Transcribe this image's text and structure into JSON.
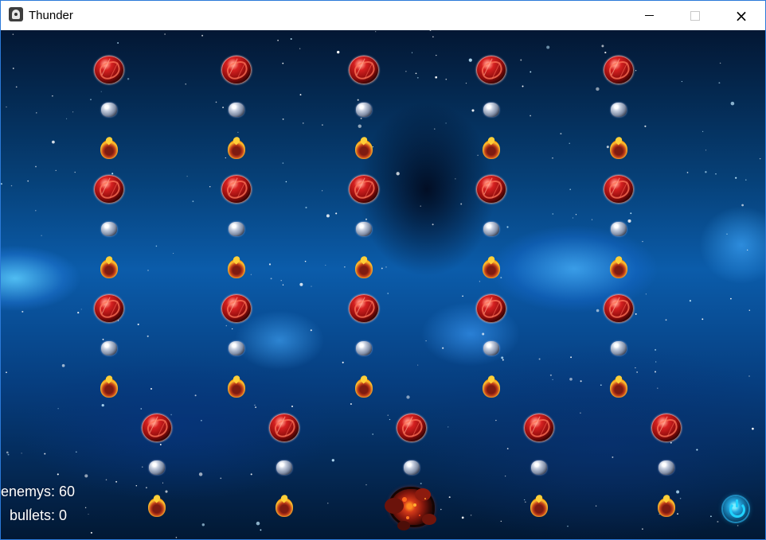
{
  "window": {
    "title": "Thunder",
    "minimize_icon": "minimize-icon",
    "maximize_icon": "maximize-icon",
    "close_icon": "close-icon",
    "close_glyph": "×"
  },
  "game": {
    "stats": {
      "enemy_count_label": "enemys: 60",
      "bullet_count_label": "bullets: 0"
    },
    "background": "starry blue space",
    "enemy_types": [
      "red-rock-enemy",
      "gray-rock-enemy",
      "fire-orb-enemy"
    ],
    "player": "exploding player ship",
    "power_icon": "power-icon"
  }
}
